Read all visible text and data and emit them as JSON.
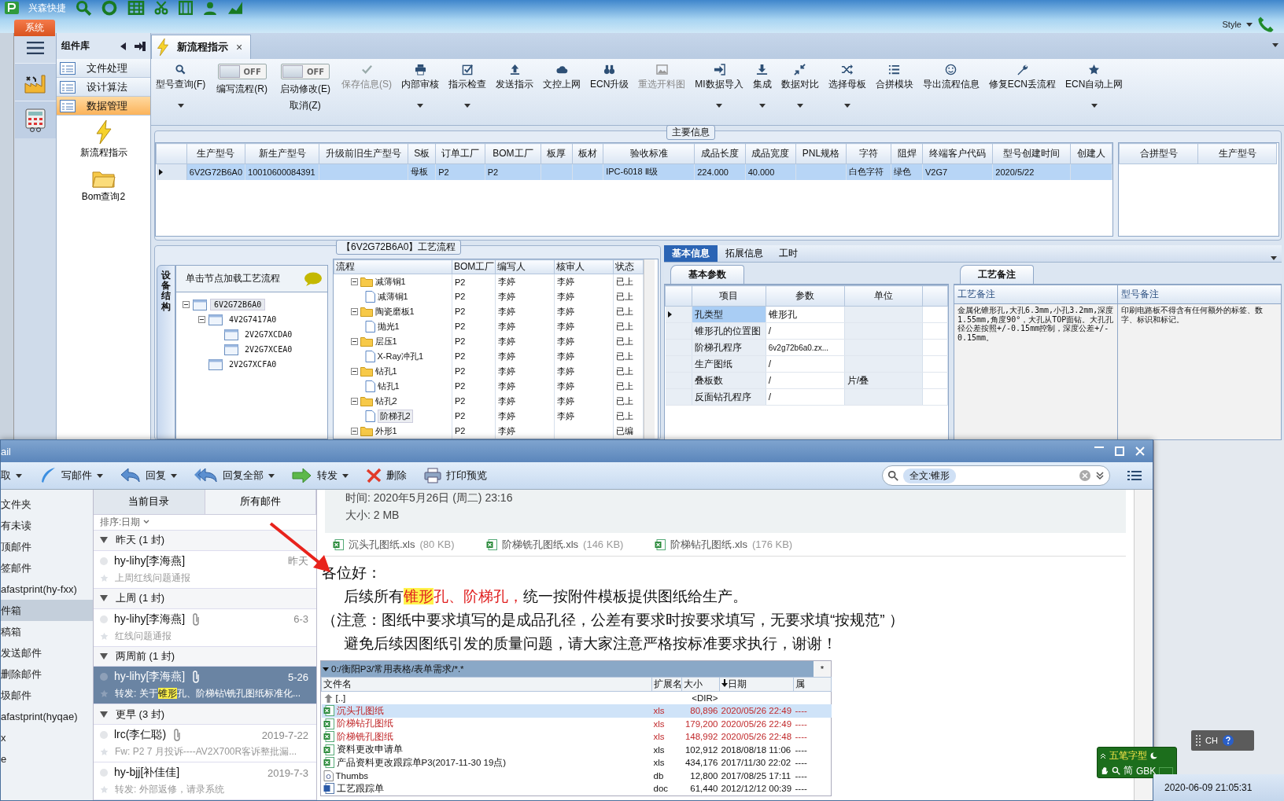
{
  "app": {
    "quick_access": "兴森快捷",
    "system_tab": "系统",
    "style_menu": "Style"
  },
  "library": {
    "title": "组件库",
    "items": [
      {
        "label": "文件处理",
        "selected": false
      },
      {
        "label": "设计算法",
        "selected": false
      },
      {
        "label": "数据管理",
        "selected": true
      }
    ],
    "tools": [
      {
        "label": "新流程指示",
        "kind": "bolt"
      },
      {
        "label": "Bom查询2",
        "kind": "folder"
      }
    ]
  },
  "doc_tab": {
    "label": "新流程指示",
    "close": "×",
    "selected": true
  },
  "ribbon": [
    {
      "kind": "button",
      "label": "型号查询(F)",
      "dropdown": true,
      "disabled": false
    },
    {
      "kind": "toggle",
      "label": "编写流程(R)",
      "switch": "OFF",
      "on": false
    },
    {
      "kind": "toggle",
      "label": "启动修改(E)",
      "label2": "取消(Z)",
      "switch": "OFF",
      "on": false
    },
    {
      "kind": "button",
      "label": "保存信息(S)",
      "dropdown": false,
      "disabled": true
    },
    {
      "kind": "button",
      "label": "内部审核",
      "dropdown": true,
      "disabled": false
    },
    {
      "kind": "button",
      "label": "指示检查",
      "dropdown": true,
      "disabled": false
    },
    {
      "kind": "button",
      "label": "发送指示",
      "dropdown": false,
      "disabled": false
    },
    {
      "kind": "button",
      "label": "文控上网",
      "dropdown": false,
      "disabled": false
    },
    {
      "kind": "button",
      "label": "ECN升级",
      "dropdown": false,
      "disabled": false
    },
    {
      "kind": "button",
      "label": "重选开料图",
      "dropdown": false,
      "disabled": true
    },
    {
      "kind": "button",
      "label": "MI数据导入",
      "dropdown": true,
      "disabled": false
    },
    {
      "kind": "button",
      "label": "集成",
      "dropdown": true,
      "disabled": false
    },
    {
      "kind": "button",
      "label": "数据对比",
      "dropdown": true,
      "disabled": false
    },
    {
      "kind": "button",
      "label": "选择母板",
      "dropdown": true,
      "disabled": false
    },
    {
      "kind": "button",
      "label": "合拼模块",
      "dropdown": false,
      "disabled": false
    },
    {
      "kind": "button",
      "label": "导出流程信息",
      "dropdown": false,
      "disabled": false
    },
    {
      "kind": "button",
      "label": "修复ECN丢流程",
      "dropdown": false,
      "disabled": false
    },
    {
      "kind": "button",
      "label": "ECN自动上网",
      "dropdown": true,
      "disabled": false
    }
  ],
  "main_info": {
    "title": "主要信息",
    "columns": [
      "生产型号",
      "新生产型号",
      "升级前旧生产型号",
      "S板",
      "订单工厂",
      "BOM工厂",
      "板厚",
      "板材",
      "验收标准",
      "成品长度",
      "成品宽度",
      "PNL规格",
      "字符",
      "阻焊",
      "终端客户代码",
      "型号创建时间",
      "创建人"
    ],
    "rows": [
      {
        "selected": true,
        "cells": [
          "6V2G72B6A0",
          "10010600084391",
          null,
          "母板",
          "P2",
          "P2",
          null,
          null,
          "IPC-6018 Ⅱ级",
          "224.000",
          "40.000",
          null,
          "白色字符",
          "绿色",
          "V2G7",
          "2020/5/22",
          null
        ]
      }
    ]
  },
  "merge_table": {
    "columns": [
      "合拼型号",
      "生产型号"
    ]
  },
  "process": {
    "title": "【6V2G72B6A0】工艺流程",
    "side_tab": "设备结构",
    "hint": "单击节点加载工艺流程",
    "tree": [
      {
        "label": "6V2G72B6A0",
        "selected": true,
        "expanded": true,
        "children": [
          {
            "label": "4V2G7417A0",
            "selected": false,
            "expanded": true,
            "children": [
              {
                "label": "2V2G7XCDA0",
                "selected": false
              },
              {
                "label": "2V2G7XCEA0",
                "selected": false
              }
            ]
          },
          {
            "label": "2V2G7XCFA0",
            "selected": false
          }
        ]
      }
    ],
    "columns": [
      "流程",
      "BOM工厂",
      "编写人",
      "核审人",
      "状态"
    ],
    "rows": [
      {
        "name": "减薄铜1",
        "factory": "P2",
        "writer": "李婷",
        "reviewer": "李婷",
        "status": "已上",
        "selected": false,
        "expanded": true,
        "children": [
          {
            "name": "减薄铜1",
            "factory": "P2",
            "writer": "李婷",
            "reviewer": "李婷",
            "status": "已上",
            "selected": false
          }
        ]
      },
      {
        "name": "陶瓷磨板1",
        "factory": "P2",
        "writer": "李婷",
        "reviewer": "李婷",
        "status": "已上",
        "selected": false,
        "expanded": true,
        "children": [
          {
            "name": "抛光1",
            "factory": "P2",
            "writer": "李婷",
            "reviewer": "李婷",
            "status": "已上",
            "selected": false
          }
        ]
      },
      {
        "name": "层压1",
        "factory": "P2",
        "writer": "李婷",
        "reviewer": "李婷",
        "status": "已上",
        "selected": false,
        "expanded": true,
        "children": [
          {
            "name": "X-Ray冲孔1",
            "factory": "P2",
            "writer": "李婷",
            "reviewer": "李婷",
            "status": "已上",
            "selected": false
          }
        ]
      },
      {
        "name": "钻孔1",
        "factory": "P2",
        "writer": "李婷",
        "reviewer": "李婷",
        "status": "已上",
        "selected": false,
        "expanded": true,
        "children": [
          {
            "name": "钻孔1",
            "factory": "P2",
            "writer": "李婷",
            "reviewer": "李婷",
            "status": "已上",
            "selected": false
          }
        ]
      },
      {
        "name": "钻孔2",
        "factory": "P2",
        "writer": "李婷",
        "reviewer": "李婷",
        "status": "已上",
        "selected": false,
        "expanded": true,
        "children": [
          {
            "name": "阶梯孔2",
            "factory": "P2",
            "writer": "李婷",
            "reviewer": "李婷",
            "status": "已上",
            "selected": true
          }
        ]
      },
      {
        "name": "外形1",
        "factory": "P2",
        "writer": "李婷",
        "status": "已编",
        "selected": false,
        "expanded": true
      }
    ]
  },
  "detail": {
    "tabs": [
      {
        "label": "基本信息",
        "selected": true
      },
      {
        "label": "拓展信息",
        "selected": false
      },
      {
        "label": "工时",
        "selected": false
      }
    ],
    "params_tab": "基本参数",
    "params_columns": [
      "项目",
      "参数",
      "单位"
    ],
    "params": [
      {
        "item": "孔类型",
        "value": "锥形孔",
        "selected": true
      },
      {
        "item": "锥形孔的位置图",
        "value": "/",
        "selected": false
      },
      {
        "item": "阶梯孔程序",
        "value": "6v2g72b6a0.zx...",
        "selected": false
      },
      {
        "item": "生产图纸",
        "value": "/",
        "selected": false
      },
      {
        "item": "叠板数",
        "value": "/",
        "unit": "片/叠",
        "selected": false
      },
      {
        "item": "反面钻孔程序",
        "value": "/",
        "selected": false
      }
    ],
    "notes_tab": "工艺备注",
    "notes_columns": [
      "工艺备注",
      "型号备注"
    ],
    "process_note": "金属化锥形孔,大孔6.3mm,小孔3.2mm,深度1.55mm,角度90°，大孔从TOP面钻。大孔孔径公差按照+/-0.15mm控制，深度公差+/-0.15mm。",
    "model_note": "印刷电路板不得含有任何额外的标签、数字、标识和标记。"
  },
  "mail": {
    "title": "ail",
    "toolbar": [
      {
        "label": "取",
        "dropdown": true
      },
      {
        "label": "写邮件",
        "dropdown": true
      },
      {
        "label": "回复",
        "dropdown": true
      },
      {
        "label": "回复全部",
        "dropdown": true
      },
      {
        "label": "转发",
        "dropdown": true
      },
      {
        "label": "删除",
        "dropdown": false
      },
      {
        "label": "打印预览",
        "dropdown": false
      }
    ],
    "search_token": "全文:锥形",
    "folders": [
      {
        "label": "文件夹",
        "selected": false
      },
      {
        "label": "有未读",
        "selected": false
      },
      {
        "label": "顶邮件",
        "selected": false
      },
      {
        "label": "签邮件",
        "selected": false
      },
      {
        "label": "afastprint(hy-fxx)",
        "selected": false
      },
      {
        "label": "件箱",
        "selected": true
      },
      {
        "label": "稿箱",
        "selected": false
      },
      {
        "label": "发送邮件",
        "selected": false
      },
      {
        "label": "删除邮件",
        "selected": false
      },
      {
        "label": "圾邮件",
        "selected": false
      },
      {
        "label": "afastprint(hyqae)",
        "selected": false
      },
      {
        "label": "x",
        "selected": false
      },
      {
        "label": "e",
        "selected": false
      }
    ],
    "list_tabs": [
      {
        "label": "当前目录",
        "selected": true
      },
      {
        "label": "所有邮件",
        "selected": false
      }
    ],
    "sort": "排序:日期",
    "groups": [
      {
        "label": "昨天 (1 封)",
        "messages": [
          {
            "sender": "hy-lihy[李海燕]",
            "date": "昨天",
            "attachment": false,
            "selected": false,
            "subject": [
              {
                "text": "上周红线问题通报",
                "kind": "plain"
              }
            ]
          }
        ]
      },
      {
        "label": "上周 (1 封)",
        "messages": [
          {
            "sender": "hy-lihy[李海燕]",
            "date": "6-3",
            "attachment": true,
            "selected": false,
            "subject": [
              {
                "text": "红线问题通报",
                "kind": "plain"
              }
            ]
          }
        ]
      },
      {
        "label": "两周前 (1 封)",
        "messages": [
          {
            "sender": "hy-lihy[李海燕]",
            "date": "5-26",
            "attachment": true,
            "selected": true,
            "subject": [
              {
                "text": "转发: 关于",
                "kind": "plain"
              },
              {
                "text": "锥形",
                "kind": "highlight"
              },
              {
                "text": "孔、阶梯钻\\铣孔图纸标准化...",
                "kind": "plain"
              }
            ]
          }
        ]
      },
      {
        "label": "更早 (3 封)",
        "messages": [
          {
            "sender": "lrc(李仁聪)",
            "date": "2019-7-22",
            "attachment": true,
            "selected": false,
            "subject": [
              {
                "text": "Fw: P2  7 月投诉----AV2X700R客诉整批漏...",
                "kind": "plain"
              }
            ]
          },
          {
            "sender": "hy-bjj[补佳佳]",
            "date": "2019-7-3",
            "attachment": false,
            "selected": false,
            "subject": [
              {
                "text": "转发: 外部返修，请录系统",
                "kind": "plain"
              }
            ]
          }
        ]
      }
    ],
    "message": {
      "time": "时间: 2020年5月26日 (周二) 23:16",
      "size": "大小: 2 MB",
      "attachments": [
        {
          "name": "沉头孔图纸.xls",
          "size": "(80 KB)"
        },
        {
          "name": "阶梯铣孔图纸.xls",
          "size": "(146 KB)"
        },
        {
          "name": "阶梯钻孔图纸.xls",
          "size": "(176 KB)"
        }
      ],
      "body": [
        {
          "indent": false,
          "parts": [
            {
              "text": "各位好：",
              "kind": "plain"
            }
          ]
        },
        {
          "indent": true,
          "parts": [
            {
              "text": "后续所有",
              "kind": "plain"
            },
            {
              "text": "锥形",
              "kind": "highlight"
            },
            {
              "text": "孔、阶梯孔，",
              "kind": "red"
            },
            {
              "text": "统一按附件模板提供图纸给生产。",
              "kind": "plain"
            }
          ]
        },
        {
          "indent": false,
          "parts": [
            {
              "text": "（注意：图纸中要求填写的是成品孔径，公差有要求时按要求填写，无要求填“按规范” ）",
              "kind": "plain"
            }
          ]
        },
        {
          "indent": true,
          "parts": [
            {
              "text": "避免后续因图纸引发的质量问题，请大家注意严格按标准要求执行，谢谢！",
              "kind": "plain"
            }
          ]
        }
      ]
    },
    "file_manager": {
      "path": "0:/衡阳P3/常用表格/表单需求/*.*",
      "star": "*",
      "columns": [
        "文件名",
        "扩展名",
        "大小",
        "日期",
        "属"
      ],
      "rows": [
        {
          "kind": "parent",
          "name": "[..]",
          "size": "<DIR>",
          "marked": false,
          "selected": false
        },
        {
          "kind": "xls",
          "name": "沉头孔图纸",
          "ext": "xls",
          "size": "80,896",
          "date": "2020/05/26 22:49",
          "attr": "----",
          "marked": true,
          "selected": true
        },
        {
          "kind": "xls",
          "name": "阶梯钻孔图纸",
          "ext": "xls",
          "size": "179,200",
          "date": "2020/05/26 22:49",
          "attr": "----",
          "marked": true,
          "selected": false
        },
        {
          "kind": "xls",
          "name": "阶梯铣孔图纸",
          "ext": "xls",
          "size": "148,992",
          "date": "2020/05/26 22:48",
          "attr": "----",
          "marked": true,
          "selected": false
        },
        {
          "kind": "xls",
          "name": "资料更改申请单",
          "ext": "xls",
          "size": "102,912",
          "date": "2018/08/18 11:06",
          "attr": "----",
          "marked": false,
          "selected": false
        },
        {
          "kind": "xls",
          "name": "产品资料更改跟踪单P3(2017-11-30 19点)",
          "ext": "xls",
          "size": "434,176",
          "date": "2017/11/30 22:02",
          "attr": "----",
          "marked": false,
          "selected": false
        },
        {
          "kind": "db",
          "name": "Thumbs",
          "ext": "db",
          "size": "12,800",
          "date": "2017/08/25 17:11",
          "attr": "----",
          "marked": false,
          "selected": false
        },
        {
          "kind": "doc",
          "name": "工艺跟踪单",
          "ext": "doc",
          "size": "61,440",
          "date": "2012/12/12 00:39",
          "attr": "----",
          "marked": false,
          "selected": false
        }
      ]
    }
  },
  "desktop": {
    "ime_mode": "五笔字型",
    "ime_script": "简",
    "ime_charset": "GBK",
    "language": "CH",
    "clock": "2020-06-09 21:05:31"
  }
}
